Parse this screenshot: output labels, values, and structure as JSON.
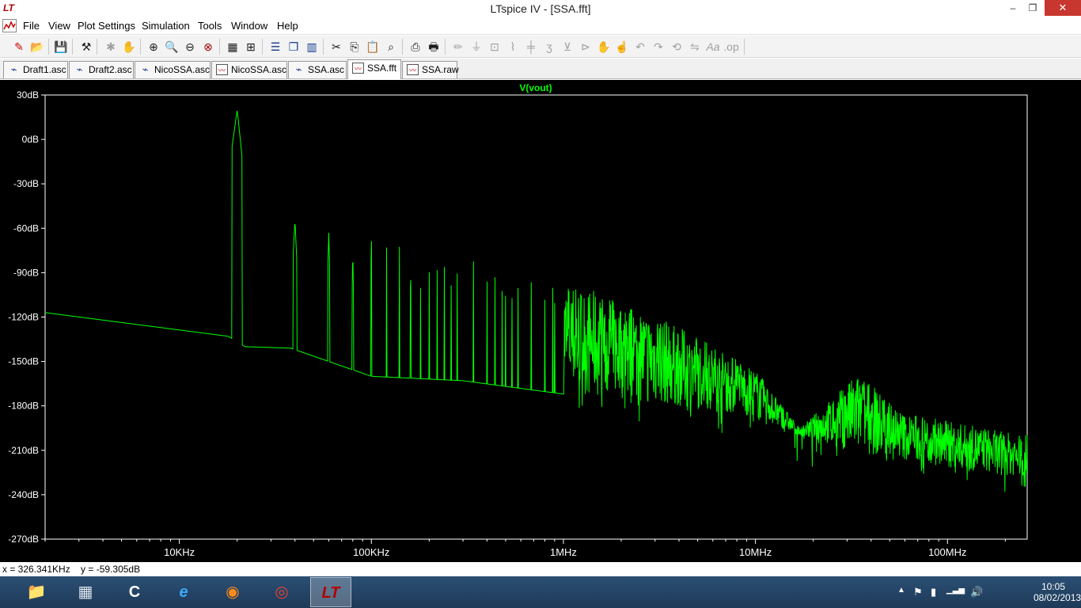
{
  "window": {
    "title": "LTspice IV - [SSA.fft]",
    "app_icon": "ltspice-logo-icon",
    "controls": {
      "minimize": "–",
      "maximize": "❐",
      "close": "✕"
    }
  },
  "menu": {
    "items": [
      "File",
      "View",
      "Plot Settings",
      "Simulation",
      "Tools",
      "Window",
      "Help"
    ],
    "mdi_controls": {
      "minimize": "–",
      "restore": "❐",
      "close": "✕"
    }
  },
  "toolbar": {
    "buttons": [
      "new-schematic-icon",
      "open-icon",
      "save-icon",
      "control-panel-icon",
      "run-icon",
      "halt-icon",
      "zoom-in-icon",
      "zoom-out-icon",
      "zoom-back-icon",
      "zoom-full-icon",
      "autorange-icon",
      "cursor-plot-icon",
      "tile-horizontal-icon",
      "cascade-icon",
      "tile-vertical-icon",
      "cut-icon",
      "copy-icon",
      "paste-icon",
      "find-icon",
      "print-preview-icon",
      "print-icon",
      "wire-icon",
      "ground-icon",
      "label-icon",
      "resistor-icon",
      "capacitor-icon",
      "inductor-icon",
      "diode-icon",
      "component-icon",
      "move-icon",
      "drag-icon",
      "undo-icon",
      "redo-icon",
      "rotate-icon",
      "mirror-icon",
      "text-icon",
      "spice-directive-icon"
    ]
  },
  "tabs": [
    {
      "label": "Draft1.asc",
      "icon": "schematic-icon",
      "active": false
    },
    {
      "label": "Draft2.asc",
      "icon": "schematic-icon",
      "active": false
    },
    {
      "label": "NicoSSA.asc",
      "icon": "schematic-icon",
      "active": false
    },
    {
      "label": "NicoSSA.asc",
      "icon": "waveform-icon",
      "active": false
    },
    {
      "label": "SSA.asc",
      "icon": "schematic-icon",
      "active": false
    },
    {
      "label": "SSA.fft",
      "icon": "waveform-icon",
      "active": true
    },
    {
      "label": "SSA.raw",
      "icon": "waveform-icon",
      "active": false
    }
  ],
  "chart_data": {
    "type": "line",
    "title": "",
    "series": [
      {
        "name": "V(vout)",
        "color": "#00ff00"
      }
    ],
    "xscale": "log",
    "xlim": [
      2000,
      260000000
    ],
    "ylim": [
      -270,
      30
    ],
    "y_ticks": [
      "30dB",
      "0dB",
      "-30dB",
      "-60dB",
      "-90dB",
      "-120dB",
      "-150dB",
      "-180dB",
      "-210dB",
      "-240dB",
      "-270dB"
    ],
    "y_tick_values": [
      30,
      0,
      -30,
      -60,
      -90,
      -120,
      -150,
      -180,
      -210,
      -240,
      -270
    ],
    "x_ticks": [
      "10KHz",
      "100KHz",
      "1MHz",
      "10MHz",
      "100MHz"
    ],
    "x_tick_values": [
      10000,
      100000,
      1000000,
      10000000,
      100000000
    ],
    "fundamental_hz": 20000,
    "peaks": [
      {
        "f": 20000,
        "db": 20
      },
      {
        "f": 40000,
        "db": -55
      },
      {
        "f": 60000,
        "db": -63
      },
      {
        "f": 80000,
        "db": -76
      },
      {
        "f": 100000,
        "db": -64
      },
      {
        "f": 120000,
        "db": -72
      },
      {
        "f": 140000,
        "db": -70
      },
      {
        "f": 160000,
        "db": -76
      },
      {
        "f": 200000,
        "db": -80
      },
      {
        "f": 400000,
        "db": -82
      },
      {
        "f": 1000000,
        "db": -94
      },
      {
        "f": 3000000,
        "db": -118
      },
      {
        "f": 10000000,
        "db": -155
      },
      {
        "f": 17000000,
        "db": -195
      },
      {
        "f": 34000000,
        "db": -158
      },
      {
        "f": 60000000,
        "db": -185
      },
      {
        "f": 100000000,
        "db": -190
      },
      {
        "f": 250000000,
        "db": -200
      }
    ],
    "noise_floor": [
      {
        "f": 2000,
        "db": -117
      },
      {
        "f": 18000,
        "db": -133
      },
      {
        "f": 22000,
        "db": -140
      },
      {
        "f": 38000,
        "db": -141
      },
      {
        "f": 60000,
        "db": -150
      },
      {
        "f": 100000,
        "db": -160
      },
      {
        "f": 300000,
        "db": -163
      },
      {
        "f": 1000000,
        "db": -172
      },
      {
        "f": 3000000,
        "db": -178
      },
      {
        "f": 10000000,
        "db": -188
      },
      {
        "f": 17000000,
        "db": -200
      },
      {
        "f": 30000000,
        "db": -210
      },
      {
        "f": 100000000,
        "db": -222
      },
      {
        "f": 250000000,
        "db": -228
      }
    ],
    "grid": false,
    "legend": "top-center"
  },
  "status": {
    "cursor_readout": "x = 326.341KHz    y = -59.305dB"
  },
  "taskbar": {
    "apps": [
      {
        "icon": "file-explorer-icon",
        "glyph": "📁"
      },
      {
        "icon": "calculator-icon",
        "glyph": "▦"
      },
      {
        "icon": "ccleaner-icon",
        "glyph": "C"
      },
      {
        "icon": "internet-explorer-icon",
        "glyph": "e"
      },
      {
        "icon": "firefox-icon",
        "glyph": "◉"
      },
      {
        "icon": "chrome-icon",
        "glyph": "◎"
      },
      {
        "icon": "ltspice-icon",
        "glyph": "LT"
      }
    ],
    "clock_time": "10:05",
    "clock_date": "08/02/2013",
    "tray": [
      "▲",
      "⚑",
      "▮",
      "▁▃▅",
      "🔊"
    ]
  }
}
